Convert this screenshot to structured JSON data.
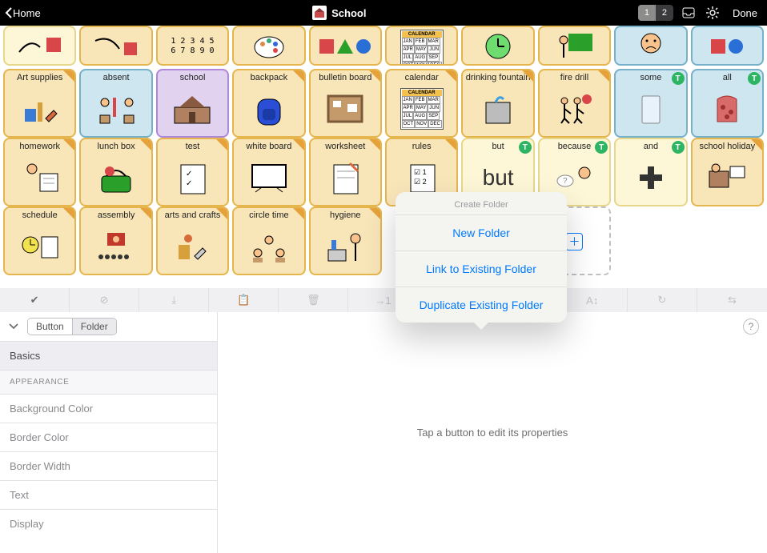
{
  "header": {
    "home_label": "Home",
    "title": "School",
    "pages": [
      "1",
      "2"
    ],
    "active_page": 0,
    "done_label": "Done"
  },
  "grid": {
    "row0": [
      {
        "label": "",
        "color": "soft",
        "icon": "hand-square"
      },
      {
        "label": "",
        "color": "yellow",
        "icon": "arm-square"
      },
      {
        "label": "",
        "color": "yellow",
        "icon": "numbers"
      },
      {
        "label": "",
        "color": "yellow",
        "icon": "palette"
      },
      {
        "label": "",
        "color": "yellow",
        "icon": "shapes"
      },
      {
        "label": "",
        "color": "yellow",
        "icon": "calendar-mini"
      },
      {
        "label": "",
        "color": "yellow",
        "icon": "clock"
      },
      {
        "label": "",
        "color": "yellow",
        "icon": "teacher"
      },
      {
        "label": "",
        "color": "blue",
        "icon": "face-sad"
      },
      {
        "label": "",
        "color": "blue",
        "icon": "square-circle"
      }
    ],
    "row1": [
      {
        "label": "Art supplies",
        "color": "yellow",
        "corner": true,
        "icon": "art-supplies"
      },
      {
        "label": "absent",
        "color": "blue",
        "icon": "absent"
      },
      {
        "label": "school",
        "color": "purple",
        "icon": "school-building"
      },
      {
        "label": "backpack",
        "color": "yellow",
        "corner": true,
        "icon": "backpack"
      },
      {
        "label": "bulletin board",
        "color": "yellow",
        "corner": true,
        "icon": "bulletin"
      },
      {
        "label": "calendar",
        "color": "yellow",
        "corner": true,
        "icon": "calendar"
      },
      {
        "label": "drinking fountain",
        "color": "yellow",
        "corner": true,
        "icon": "fountain"
      },
      {
        "label": "fire drill",
        "color": "yellow",
        "corner": true,
        "icon": "fire-drill"
      },
      {
        "label": "some",
        "color": "blue",
        "badge": "T",
        "icon": "glass"
      },
      {
        "label": "all",
        "color": "blue",
        "badge": "T",
        "icon": "bag"
      }
    ],
    "row2": [
      {
        "label": "homework",
        "color": "yellow",
        "corner": true,
        "icon": "homework"
      },
      {
        "label": "lunch box",
        "color": "yellow",
        "corner": true,
        "icon": "lunchbox"
      },
      {
        "label": "test",
        "color": "yellow",
        "corner": true,
        "icon": "test"
      },
      {
        "label": "white board",
        "color": "yellow",
        "corner": true,
        "icon": "whiteboard"
      },
      {
        "label": "worksheet",
        "color": "yellow",
        "corner": true,
        "icon": "worksheet"
      },
      {
        "label": "rules",
        "color": "yellow",
        "corner": true,
        "icon": "rules"
      },
      {
        "label": "but",
        "color": "soft",
        "badge": "T",
        "bigtext": true
      },
      {
        "label": "because",
        "color": "soft",
        "badge": "T",
        "icon": "because"
      },
      {
        "label": "and",
        "color": "soft",
        "badge": "T",
        "icon": "plus"
      },
      {
        "label": "school holiday",
        "color": "yellow",
        "corner": true,
        "icon": "holiday"
      }
    ],
    "row3": [
      {
        "label": "schedule",
        "color": "yellow",
        "corner": true,
        "icon": "schedule"
      },
      {
        "label": "assembly",
        "color": "yellow",
        "corner": true,
        "icon": "assembly"
      },
      {
        "label": "arts and crafts",
        "color": "yellow",
        "corner": true,
        "icon": "crafts"
      },
      {
        "label": "circle time",
        "color": "yellow",
        "corner": true,
        "icon": "circle-time"
      },
      {
        "label": "hygiene",
        "color": "yellow",
        "corner": true,
        "icon": "hygiene"
      },
      {
        "empty_spacer": true
      },
      {
        "empty_spacer": true
      },
      {
        "empty": true,
        "icon": "add"
      },
      {
        "empty_blank": true
      },
      {
        "empty_blank": true
      }
    ]
  },
  "toolbar": {
    "items": [
      {
        "name": "check-icon",
        "glyph": "✔",
        "active": true
      },
      {
        "name": "cancel-icon",
        "glyph": "⊘"
      },
      {
        "name": "import-icon",
        "glyph": "⤓"
      },
      {
        "name": "paste-icon",
        "glyph": "📋"
      },
      {
        "name": "trash-icon",
        "glyph": "🗑"
      },
      {
        "name": "goto-icon",
        "glyph": "→1"
      },
      {
        "name": "spacer",
        "glyph": ""
      },
      {
        "name": "spacer2",
        "glyph": ""
      },
      {
        "name": "sort-az-icon",
        "glyph": "A↕"
      },
      {
        "name": "refresh-icon",
        "glyph": "↻"
      },
      {
        "name": "swap-icon",
        "glyph": "⇆"
      }
    ]
  },
  "editor": {
    "segmented": [
      "Button",
      "Folder"
    ],
    "segmented_selected": 1,
    "items": [
      {
        "label": "Basics",
        "kind": "item",
        "selected": true
      },
      {
        "label": "APPEARANCE",
        "kind": "group"
      },
      {
        "label": "Background Color",
        "kind": "item",
        "muted": true
      },
      {
        "label": "Border Color",
        "kind": "item",
        "muted": true
      },
      {
        "label": "Border Width",
        "kind": "item",
        "muted": true
      },
      {
        "label": "Text",
        "kind": "item",
        "muted": true
      },
      {
        "label": "Display",
        "kind": "item",
        "muted": true
      }
    ],
    "placeholder": "Tap a button to edit its properties"
  },
  "popover": {
    "title": "Create Folder",
    "items": [
      "New Folder",
      "Link to Existing Folder",
      "Duplicate Existing Folder"
    ]
  },
  "icons": {
    "numbers_text_top": "1 2 3 4 5",
    "numbers_text_bot": "6 7 8 9 0",
    "calendar_header": "CALENDAR",
    "months": [
      "JAN",
      "FEB",
      "MAR",
      "APR",
      "MAY",
      "JUN",
      "JUL",
      "AUG",
      "SEP",
      "OCT",
      "NOV",
      "DEC"
    ]
  }
}
